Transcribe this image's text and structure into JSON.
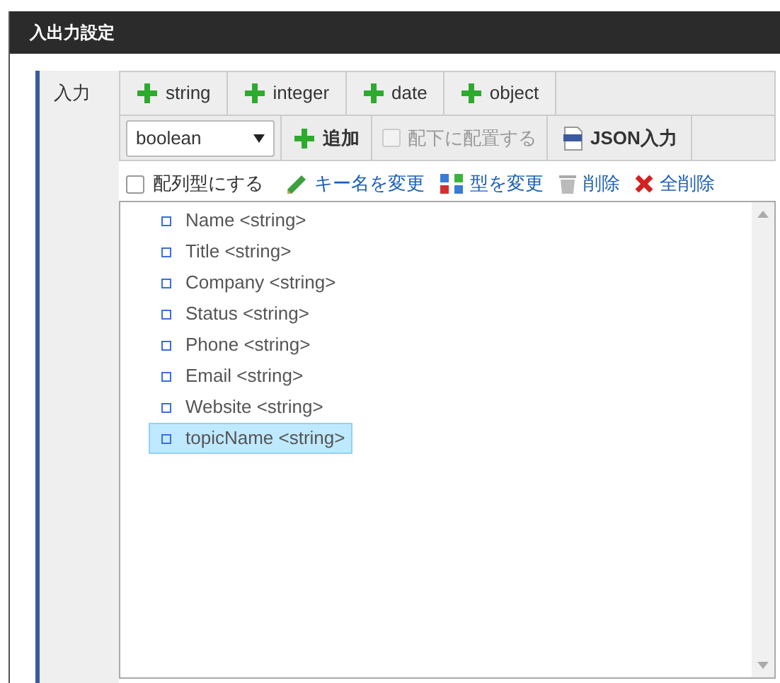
{
  "dialog": {
    "title": "入出力設定"
  },
  "section": {
    "label": "入力"
  },
  "type_buttons": [
    "string",
    "integer",
    "date",
    "object"
  ],
  "type_select": {
    "value": "boolean"
  },
  "add_button": "追加",
  "nest_checkbox": {
    "label": "配下に配置する",
    "checked": false,
    "disabled": true
  },
  "json_button": "JSON入力",
  "array_checkbox": {
    "label": "配列型にする",
    "checked": false
  },
  "actions": [
    {
      "kind": "rename",
      "label": "キー名を変更"
    },
    {
      "kind": "retype",
      "label": "型を変更"
    },
    {
      "kind": "delete",
      "label": "削除"
    },
    {
      "kind": "delete_all",
      "label": "全削除"
    }
  ],
  "tree": [
    {
      "label": "Name <string>",
      "selected": false
    },
    {
      "label": "Title <string>",
      "selected": false
    },
    {
      "label": "Company <string>",
      "selected": false
    },
    {
      "label": "Status <string>",
      "selected": false
    },
    {
      "label": "Phone <string>",
      "selected": false
    },
    {
      "label": "Email <string>",
      "selected": false
    },
    {
      "label": "Website <string>",
      "selected": false
    },
    {
      "label": "topicName <string>",
      "selected": true
    }
  ]
}
